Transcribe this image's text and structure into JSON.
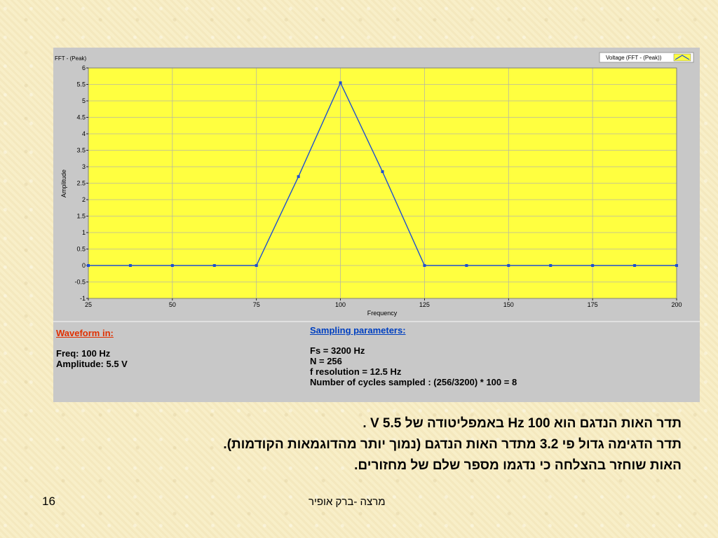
{
  "chart_panel": {
    "plot_title": "FFT - (Peak)",
    "legend_label": "Voltage (FFT - (Peak))"
  },
  "chart_data": {
    "type": "line",
    "xlabel": "Frequency",
    "ylabel": "Amplitude",
    "xlim": [
      25,
      200
    ],
    "ylim": [
      -1,
      6
    ],
    "x_ticks": [
      "25",
      "50",
      "75",
      "100",
      "125",
      "150",
      "175",
      "200"
    ],
    "y_ticks": [
      "-1",
      "-0.5",
      "0",
      "0.5",
      "1",
      "1.5",
      "2",
      "2.5",
      "3",
      "3.5",
      "4",
      "4.5",
      "5",
      "5.5",
      "6"
    ],
    "grid": true,
    "legend_position": "top-right",
    "series": [
      {
        "name": "Voltage (FFT - (Peak))",
        "x": [
          25,
          37.5,
          50,
          62.5,
          75,
          87.5,
          100,
          112.5,
          125,
          137.5,
          150,
          162.5,
          175,
          187.5,
          200
        ],
        "y": [
          0,
          0,
          0,
          0,
          0,
          2.7,
          5.55,
          2.85,
          0,
          0,
          0,
          0,
          0,
          0,
          0
        ]
      }
    ],
    "colors": {
      "plot_background": "#ffff40",
      "line": "#1e4fd0",
      "panel": "#c8c8c8"
    }
  },
  "info": {
    "waveform_heading": "Waveform in:",
    "freq": "Freq: 100 Hz",
    "amplitude": "Amplitude: 5.5 V",
    "sampling_heading": "Sampling parameters:",
    "fs": "Fs = 3200 Hz",
    "n": "N = 256",
    "f_resolution": "f resolution = 12.5 Hz",
    "cycles": "Number of cycles sampled : (256/3200) * 100  = 8",
    "waveform_color": "#e03000",
    "sampling_color": "#0040c0"
  },
  "text": {
    "line1": "תדר האות הנדגם הוא 100 Hz באמפליטודה של   5.5 V  .",
    "line2": "תדר הדגימה גדול פי 3.2 מתדר האות הנדגם (נמוך יותר מהדוגמאות הקודמות).",
    "line3": "האות שוחזר בהצלחה כי נדגמו מספר שלם של מחזורים."
  },
  "footer": {
    "page_number": "16",
    "author": "מרצה  -ברק אופיר"
  }
}
